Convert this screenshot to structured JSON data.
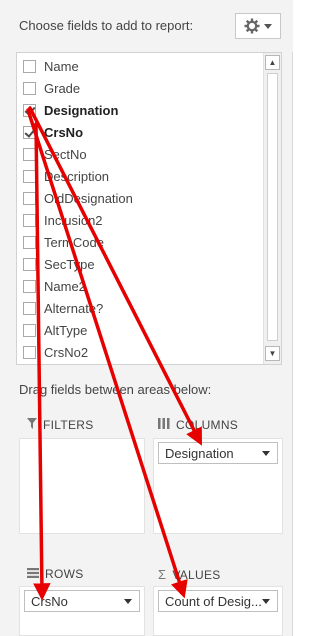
{
  "header": {
    "title": "Choose fields to add to report:",
    "settings_icon": "gear-icon"
  },
  "fields": [
    {
      "label": "Name",
      "checked": false,
      "bold": false
    },
    {
      "label": "Grade",
      "checked": false,
      "bold": false
    },
    {
      "label": "Designation",
      "checked": true,
      "bold": true
    },
    {
      "label": "CrsNo",
      "checked": true,
      "bold": true
    },
    {
      "label": "SectNo",
      "checked": false,
      "bold": false
    },
    {
      "label": "Description",
      "checked": false,
      "bold": false
    },
    {
      "label": "OldDesignation",
      "checked": false,
      "bold": false
    },
    {
      "label": "Inclusion2",
      "checked": false,
      "bold": false
    },
    {
      "label": "TermCode",
      "checked": false,
      "bold": false
    },
    {
      "label": "SecType",
      "checked": false,
      "bold": false
    },
    {
      "label": "Name2",
      "checked": false,
      "bold": false
    },
    {
      "label": "Alternate?",
      "checked": false,
      "bold": false
    },
    {
      "label": "AltType",
      "checked": false,
      "bold": false
    },
    {
      "label": "CrsNo2",
      "checked": false,
      "bold": false
    }
  ],
  "drag_label": "Drag fields between areas below:",
  "areas": {
    "filters": {
      "title": "FILTERS",
      "icon": "filter-icon"
    },
    "columns": {
      "title": "COLUMNS",
      "icon": "columns-icon",
      "field": "Designation"
    },
    "rows": {
      "title": "ROWS",
      "icon": "rows-icon",
      "field": "CrsNo"
    },
    "values": {
      "title": "VALUES",
      "icon": "sigma-icon",
      "field": "Count of Desig..."
    }
  },
  "annotation_color": "#e60000"
}
